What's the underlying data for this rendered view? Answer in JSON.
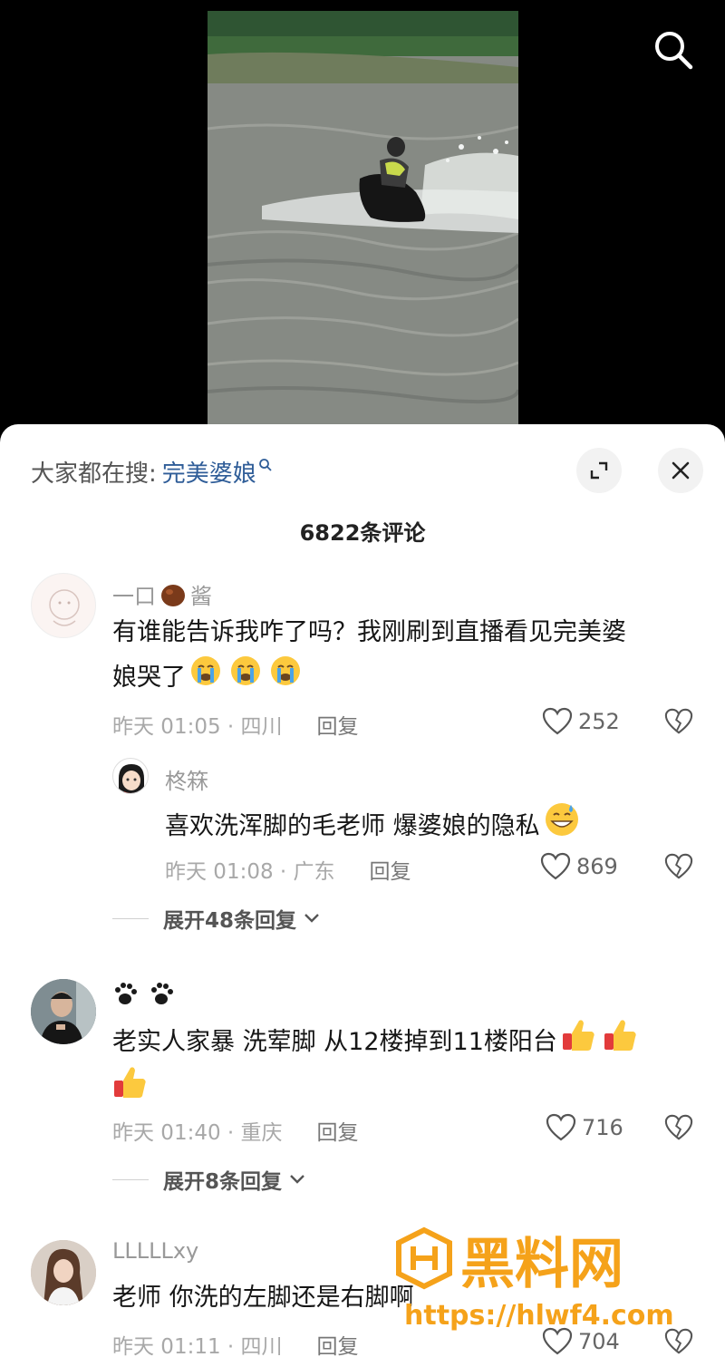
{
  "search": {
    "icon": "search-icon"
  },
  "trending": {
    "prefix": "大家都在搜:",
    "keyword": "完美婆娘"
  },
  "comment_count": "6822条评论",
  "comments": [
    {
      "user_a": "一口",
      "user_b": "酱",
      "text_line1": "有谁能告诉我咋了吗？我刚刷到直播看见完美婆",
      "text_line2": "娘哭了",
      "time": "昨天 01:05 · 四川",
      "reply": "回复",
      "likes": "252"
    },
    {
      "user": "柊箖",
      "text": "喜欢洗浑脚的毛老师 爆婆娘的隐私",
      "time": "昨天 01:08 · 广东",
      "reply": "回复",
      "likes": "869"
    },
    {
      "expand": "展开48条回复"
    },
    {
      "user": "🐾🐾",
      "text_line1": "老实人家暴 洗荤脚 从12楼掉到11楼阳台",
      "time": "昨天 01:40 · 重庆",
      "reply": "回复",
      "likes": "716"
    },
    {
      "expand": "展开8条回复"
    },
    {
      "user": "LLLLLxy",
      "text": "老师 你洗的左脚还是右脚啊",
      "time": "昨天 01:11 · 四川",
      "reply": "回复",
      "likes": "704"
    }
  ],
  "watermark": {
    "brand": "黑料网",
    "url": "https://hlwf4.com"
  },
  "colors": {
    "keyword": "#2f5d98",
    "watermark": "#f5a21a"
  }
}
